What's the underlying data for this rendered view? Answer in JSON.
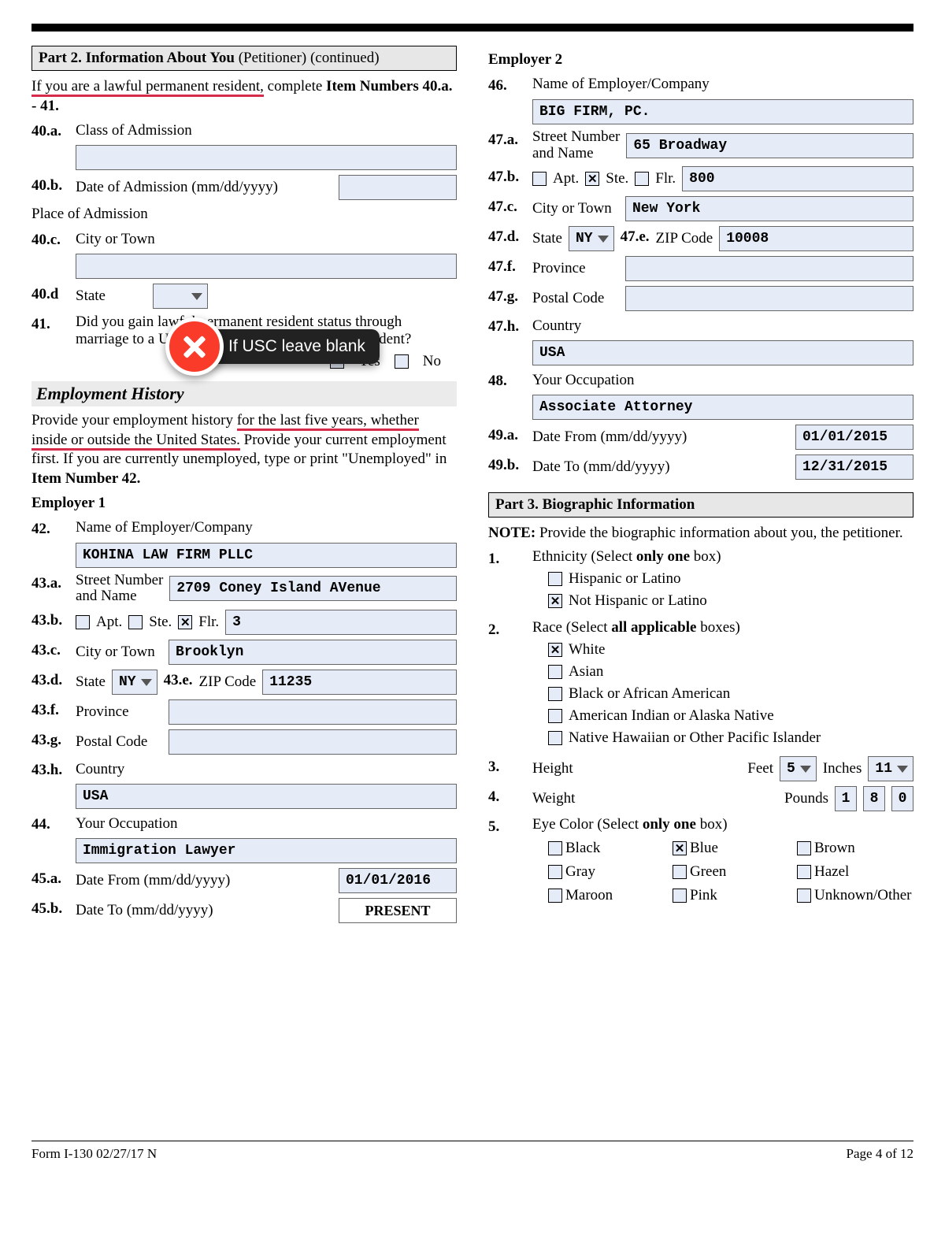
{
  "header": {
    "part2_title": "Part 2.  Information About You ",
    "part2_subtitle": "(Petitioner) (continued)"
  },
  "lpr_intro": {
    "prefix": "If you are a lawful permanent resident,",
    "suffix": " complete ",
    "bold": "Item Numbers 40.a. - 41."
  },
  "q40a_num": "40.a.",
  "q40a_label": "Class of Admission",
  "q40a_value": "",
  "q40b_num": "40.b.",
  "q40b_label": "Date of Admission (mm/dd/yyyy)",
  "q40b_value": "",
  "place_label": "Place of Admission",
  "q40c_num": "40.c.",
  "q40c_label": "City or Town",
  "q40c_value": "",
  "q40d_num": "40.d",
  "q40d_label": "State",
  "q40d_value": "",
  "q41_num": "41.",
  "q41_text": "Did you gain lawful permanent resident status through marriage to a U.S. citizen or lawful permanent resident?",
  "yes": "Yes",
  "no": "No",
  "emp_heading": "Employment History",
  "emp_intro_1": "Provide your employment history ",
  "emp_intro_underline1": "for the last five years, whether",
  "emp_intro_underline2": "inside or outside the United States.",
  "emp_intro_2": "  Provide your current employment first.  If you are currently unemployed, type or print \"Unemployed\" in ",
  "emp_intro_bold": "Item Number 42.",
  "employer1_title": "Employer 1",
  "q42_num": "42.",
  "q42_label": "Name of Employer/Company",
  "q42_value": "KOHINA LAW FIRM PLLC",
  "q43a_num": "43.a.",
  "q43a_label1": "Street Number",
  "q43a_label2": "and Name",
  "q43a_value": "2709 Coney Island AVenue",
  "q43b_num": "43.b.",
  "q43b_apt": "Apt.",
  "q43b_ste": "Ste.",
  "q43b_flr": "Flr.",
  "q43b_value": "3",
  "q43c_num": "43.c.",
  "q43c_label": "City or Town",
  "q43c_value": "Brooklyn",
  "q43d_num": "43.d.",
  "q43d_label": "State",
  "q43d_value": "NY",
  "q43e_num": "43.e.",
  "q43e_label": "ZIP Code",
  "q43e_value": "11235",
  "q43f_num": "43.f.",
  "q43f_label": "Province",
  "q43f_value": "",
  "q43g_num": "43.g.",
  "q43g_label": "Postal Code",
  "q43g_value": "",
  "q43h_num": "43.h.",
  "q43h_label": "Country",
  "q43h_value": "USA",
  "q44_num": "44.",
  "q44_label": "Your Occupation",
  "q44_value": "Immigration Lawyer",
  "q45a_num": "45.a.",
  "q45a_label": "Date From (mm/dd/yyyy)",
  "q45a_value": "01/01/2016",
  "q45b_num": "45.b.",
  "q45b_label": "Date To (mm/dd/yyyy)",
  "q45b_value": "PRESENT",
  "employer2_title": "Employer 2",
  "q46_num": "46.",
  "q46_label": "Name of Employer/Company",
  "q46_value": "BIG FIRM, PC.",
  "q47a_num": "47.a.",
  "q47a_value": "65 Broadway",
  "q47b_num": "47.b.",
  "q47b_value": "800",
  "q47c_num": "47.c.",
  "q47c_value": "New York",
  "q47d_num": "47.d.",
  "q47d_value": "NY",
  "q47e_num": "47.e.",
  "q47e_value": "10008",
  "q47f_num": "47.f.",
  "q47f_value": "",
  "q47g_num": "47.g.",
  "q47g_value": "",
  "q47h_num": "47.h.",
  "q47h_value": "USA",
  "q48_num": "48.",
  "q48_value": "Associate Attorney",
  "q49a_num": "49.a.",
  "q49a_value": "01/01/2015",
  "q49b_num": "49.b.",
  "q49b_value": "12/31/2015",
  "part3_title": "Part 3.  Biographic Information",
  "part3_note_label": "NOTE:",
  "part3_note": "  Provide the biographic information about you, the petitioner.",
  "q1_num": "1.",
  "q1_label_pre": "Ethnicity (Select ",
  "q1_label_bold": "only one",
  "q1_label_post": " box)",
  "q1_opt1": "Hispanic or Latino",
  "q1_opt2": "Not Hispanic or Latino",
  "q2_num": "2.",
  "q2_label_pre": "Race (Select ",
  "q2_label_bold": "all applicable",
  "q2_label_post": " boxes)",
  "q2_white": "White",
  "q2_asian": "Asian",
  "q2_black": "Black or African American",
  "q2_ai": "American Indian or Alaska Native",
  "q2_pi": "Native Hawaiian or Other Pacific Islander",
  "q3_num": "3.",
  "q3_label": "Height",
  "q3_feet_label": "Feet",
  "q3_feet_value": "5",
  "q3_inches_label": "Inches",
  "q3_inches_value": "11",
  "q4_num": "4.",
  "q4_label": "Weight",
  "q4_pounds_label": "Pounds",
  "q4_d1": "1",
  "q4_d2": "8",
  "q4_d3": "0",
  "q5_num": "5.",
  "q5_label_pre": "Eye Color (Select ",
  "q5_label_bold": "only one",
  "q5_label_post": " box)",
  "eye_black": "Black",
  "eye_blue": "Blue",
  "eye_brown": "Brown",
  "eye_gray": "Gray",
  "eye_green": "Green",
  "eye_hazel": "Hazel",
  "eye_maroon": "Maroon",
  "eye_pink": "Pink",
  "eye_unknown": "Unknown/Other",
  "annotation_text": "If USC leave blank",
  "footer_left": "Form I-130   02/27/17   N",
  "footer_right": "Page 4 of 12"
}
